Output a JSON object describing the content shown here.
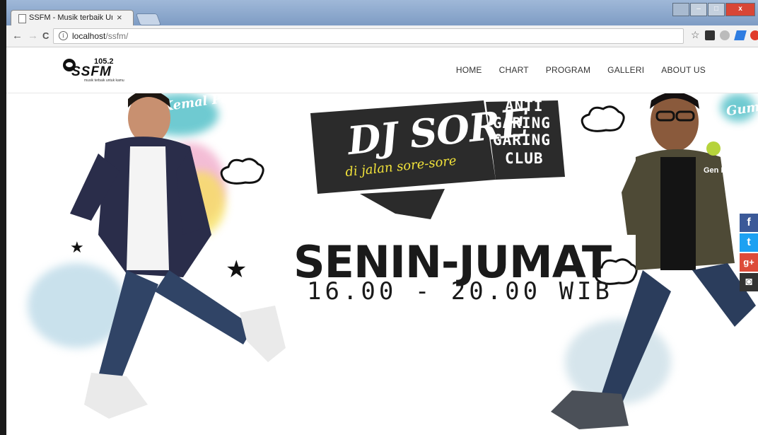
{
  "browser": {
    "tab_title": "SSFM - Musik terbaik Un",
    "tab_close": "×",
    "url_host": "localhost",
    "url_path": "/ssfm/",
    "back_glyph": "←",
    "forward_glyph": "→",
    "reload_glyph": "C",
    "info_glyph": "i",
    "star_glyph": "☆",
    "close_glyph": "x"
  },
  "site": {
    "logo": {
      "frequency": "105.2",
      "brand": "SSFM",
      "tagline": "musik terbaik untuk kamu"
    },
    "nav": [
      "HOME",
      "CHART",
      "PROGRAM",
      "GALLERI",
      "ABOUT US"
    ]
  },
  "hero": {
    "show_title": "DJ SORE",
    "show_subtitle": "di jalan sore-sore",
    "club_words": [
      "ANTI",
      "GARING",
      "GARING",
      "CLUB"
    ],
    "days": "SENIN-JUMAT",
    "hours": "16.00 - 20.00 WIB",
    "host_left": "Kemal Palevi",
    "host_right": "Gum",
    "jacket_badge": "Gen FM"
  },
  "social": [
    {
      "icon": "facebook-icon",
      "glyph": "f"
    },
    {
      "icon": "twitter-icon",
      "glyph": "t"
    },
    {
      "icon": "google-plus-icon",
      "glyph": "g+"
    },
    {
      "icon": "instagram-icon",
      "glyph": "◙"
    }
  ],
  "colors": {
    "facebook": "#3b5998",
    "twitter": "#1da1f2",
    "google_plus": "#dd4b39",
    "instagram": "#333333",
    "banner": "#2b2b2b",
    "subtitle": "#f2e33a"
  }
}
